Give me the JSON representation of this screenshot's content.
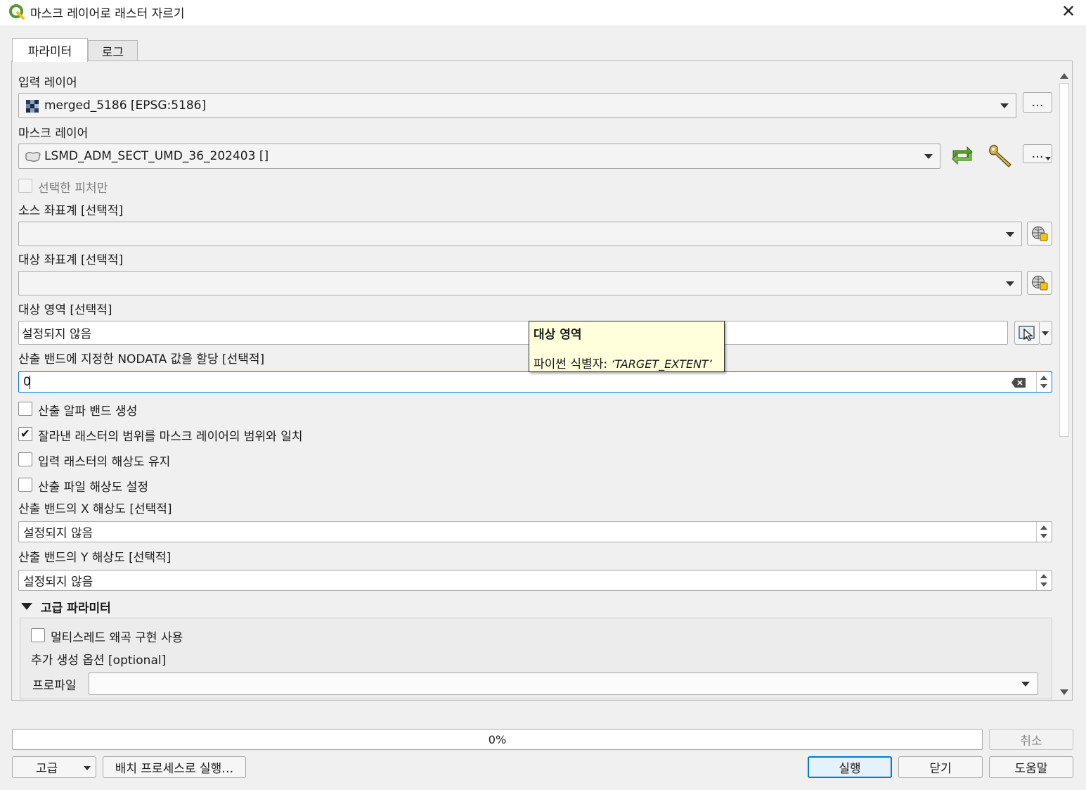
{
  "window": {
    "title": "마스크 레이어로 래스터 자르기",
    "close_glyph": "✕"
  },
  "tabs": [
    {
      "label": "파라미터",
      "active": true
    },
    {
      "label": "로그",
      "active": false
    }
  ],
  "params": {
    "input_layer": {
      "label": "입력 레이어",
      "value": "merged_5186 [EPSG:5186]",
      "more": "…"
    },
    "mask_layer": {
      "label": "마스크 레이어",
      "value": "LSMD_ADM_SECT_UMD_36_202403 []",
      "more": "…"
    },
    "selected_only": {
      "label": "선택한 피처만",
      "checked": false,
      "disabled": true
    },
    "source_crs": {
      "label": "소스 좌표계 [선택적]",
      "value": ""
    },
    "target_crs": {
      "label": "대상 좌표계 [선택적]",
      "value": ""
    },
    "target_extent": {
      "label": "대상 영역 [선택적]",
      "value": "설정되지 않음"
    },
    "nodata": {
      "label": "산출 밴드에 지정한 NODATA 값을 할당 [선택적]",
      "value": "0"
    },
    "alpha_band": {
      "label": "산출 알파 밴드 생성",
      "checked": false
    },
    "crop_to_cutline": {
      "label": "잘라낸 래스터의 범위를 마스크 레이어의 범위와 일치",
      "checked": true,
      "check_glyph": "✔"
    },
    "keep_resolution": {
      "label": "입력 래스터의 해상도 유지",
      "checked": false
    },
    "set_resolution": {
      "label": "산출 파일 해상도 설정",
      "checked": false
    },
    "x_resolution": {
      "label": "산출 밴드의 X 해상도 [선택적]",
      "value": "설정되지 않음"
    },
    "y_resolution": {
      "label": "산출 밴드의 Y 해상도 [선택적]",
      "value": "설정되지 않음"
    }
  },
  "advanced": {
    "header": "고급 파라미터",
    "multithreading": {
      "label": "멀티스레드 왜곡 구현 사용",
      "checked": false
    },
    "extra_options": {
      "label": "추가 생성 옵션 [optional]"
    },
    "profile": {
      "label": "프로파일",
      "value": ""
    }
  },
  "tooltip": {
    "title": "대상 영역",
    "body_prefix": "파이썬 식별자: ",
    "identifier": "‘TARGET_EXTENT’"
  },
  "footer": {
    "progress": {
      "value": 0,
      "text": "0%"
    },
    "cancel": "취소",
    "advanced": "고급",
    "batch": "배치 프로세스로 실행…",
    "run": "실행",
    "close": "닫기",
    "help": "도움말"
  },
  "colors": {
    "accent": "#0078d7",
    "run_border": "#0078d7",
    "tooltip_bg": "#ffffdc",
    "qgis_green": "#589632",
    "qgis_yellow": "#f0c419"
  },
  "icons": {
    "app": "qgis-logo-icon",
    "refresh": "refresh-icon",
    "wrench": "wrench-icon",
    "crs": "globe-crs-icon",
    "extent": "map-canvas-select-icon",
    "raster": "raster-layer-icon",
    "vector": "polygon-layer-icon",
    "clear": "clear-text-icon"
  }
}
